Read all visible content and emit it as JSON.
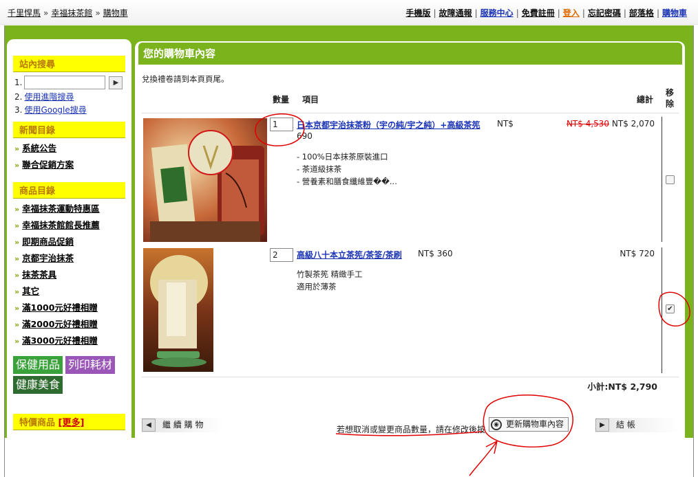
{
  "breadcrumb": {
    "items": [
      "千里悍馬",
      "幸福抹茶館",
      "購物車"
    ],
    "separator": "»"
  },
  "topnav": {
    "items": [
      "手機版",
      "故障通報",
      "服務中心",
      "免費註冊",
      "登入",
      "忘記密碼",
      "部落格",
      "購物車"
    ],
    "separator": "|"
  },
  "sidebar": {
    "search": {
      "heading": "站內搜尋",
      "row1_num": "1.",
      "row2_num": "2.",
      "row2_link": "使用進階搜尋",
      "row3_num": "3.",
      "row3_link": "使用Google搜尋",
      "go_icon": "▶"
    },
    "news": {
      "heading": "新聞目錄",
      "items": [
        "系統公告",
        "聯合促銷方案"
      ]
    },
    "products": {
      "heading": "商品目錄",
      "items": [
        "幸福抹茶運動特惠區",
        "幸福抹茶館館長推薦",
        "即期商品促銷",
        "京都宇治抹茶",
        "抹茶茶具",
        "其它",
        "滿1000元好禮相贈",
        "滿2000元好禮相贈",
        "滿3000元好禮相贈"
      ]
    },
    "bullet": "»",
    "badges": [
      "保健用品",
      "列印耗材",
      "健康美食"
    ],
    "special": {
      "heading": "特價商品",
      "more": "[更多]"
    }
  },
  "main": {
    "title": "您的購物車內容",
    "note": "兌換禮卷請到本頁頁尾。",
    "headers": {
      "qty": "數量",
      "item": "項目",
      "total": "總計",
      "remove": "移除"
    },
    "items": [
      {
        "qty": "1",
        "name": "日本京都宇治抹茶粉（宇の純/宇之純）+高級茶筅",
        "price_prefix": "NT$",
        "price": "690",
        "desc": [
          "- 100%日本抹茶原裝進口",
          "- 茶道級抹茶",
          "- 營養素和膳食纖維豐��..."
        ],
        "old_total": "NT$ 4,530",
        "total": "NT$ 2,070",
        "remove_checked": false
      },
      {
        "qty": "2",
        "name": "高級八十本立茶筅/茶筌/茶刷",
        "price_prefix": "NT$",
        "price": "360",
        "desc": [
          "竹製茶筅 精緻手工",
          "適用於薄茶"
        ],
        "total": "NT$ 720",
        "remove_checked": true
      }
    ],
    "subtotal": "小計:NT$ 2,790",
    "continue_label": "繼 續 購 物",
    "hint": "若想取消或變更商品數量，請在修改後按",
    "update_label": "更新購物車內容",
    "checkout_label": "結 帳",
    "arrow_left": "◀",
    "arrow_right": "▶"
  },
  "colors": {
    "brand_green": "#7ab31c",
    "heading_yellow": "#ffff00",
    "link_blue": "#1a33b5",
    "annotation_red": "#e00000"
  }
}
